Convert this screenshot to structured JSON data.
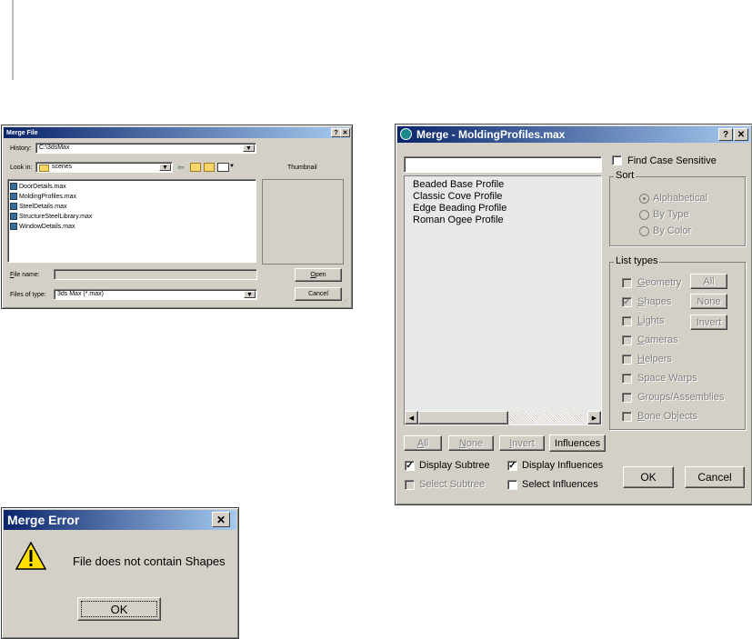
{
  "merge_file": {
    "title": "Merge File",
    "history_label": "History:",
    "history_value": "C:\\3dsMax",
    "lookin_label": "Look in:",
    "lookin_value": "scenes",
    "thumbnail_label": "Thumbnail",
    "files": [
      "DoorDetails.max",
      "MoldingProfiles.max",
      "SteelDetails.max",
      "StructureSteelLibrary.max",
      "WindowDetails.max"
    ],
    "filename_label": "File name:",
    "filename_value": "",
    "filetype_label": "Files of type:",
    "filetype_value": "3ds Max (*.max)",
    "open_label": "Open",
    "cancel_label": "Cancel"
  },
  "merge_dialog": {
    "title": "Merge - MoldingProfiles.max",
    "filter_value": "",
    "items": [
      "Beaded Base Profile",
      "Classic Cove Profile",
      "Edge Beading Profile",
      "Roman Ogee Profile"
    ],
    "find_case_label": "Find Case Sensitive",
    "sort_title": "Sort",
    "sort_options": [
      "Alphabetical",
      "By Type",
      "By Color"
    ],
    "list_types_title": "List types",
    "list_types": [
      "Geometry",
      "Shapes",
      "Lights",
      "Cameras",
      "Helpers",
      "Space Warps",
      "Groups/Assemblies",
      "Bone Objects"
    ],
    "all_label": "All",
    "none_label": "None",
    "invert_label": "Invert",
    "influences_label": "Influences",
    "display_subtree_label": "Display Subtree",
    "display_influences_label": "Display Influences",
    "select_subtree_label": "Select Subtree",
    "select_influences_label": "Select Influences",
    "ok_label": "OK",
    "cancel_label": "Cancel"
  },
  "merge_error": {
    "title": "Merge Error",
    "message": "File does not contain Shapes",
    "ok_label": "OK"
  }
}
